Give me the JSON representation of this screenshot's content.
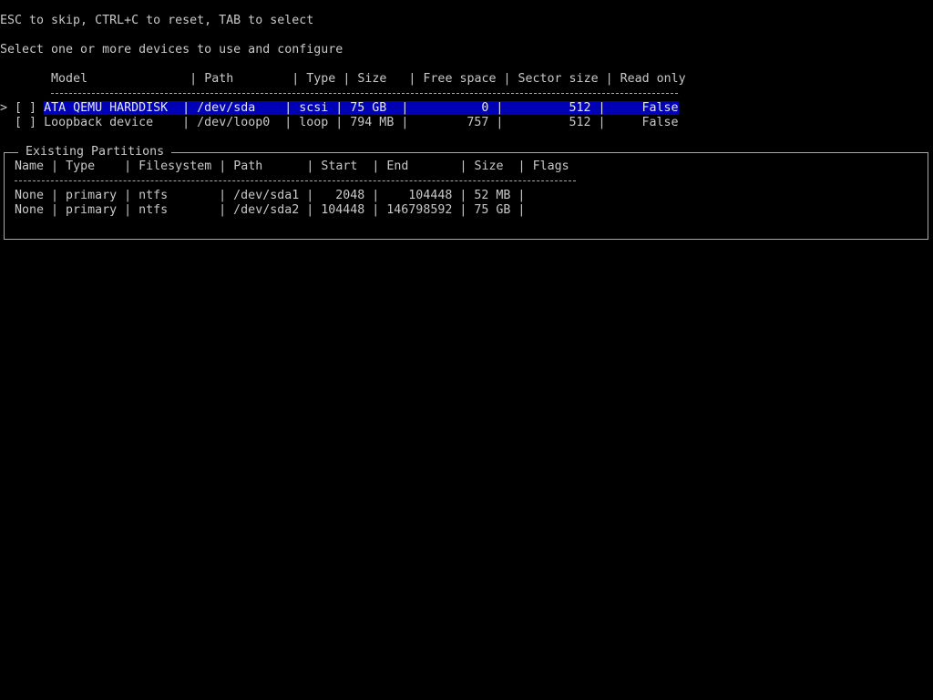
{
  "header": {
    "hint": "ESC to skip, CTRL+C to reset, TAB to select",
    "prompt": "Select one or more devices to use and configure"
  },
  "devices": {
    "columns": [
      "Model",
      "Path",
      "Type",
      "Size",
      "Free space",
      "Sector size",
      "Read only"
    ],
    "rows": [
      {
        "cursor": ">",
        "checkbox": "[ ]",
        "model": "ATA QEMU HARDDISK",
        "path": "/dev/sda",
        "type": "scsi",
        "size": "75 GB",
        "free": "0",
        "sector": "512",
        "readonly": "False",
        "selected": true
      },
      {
        "cursor": " ",
        "checkbox": "[ ]",
        "model": "Loopback device",
        "path": "/dev/loop0",
        "type": "loop",
        "size": "794 MB",
        "free": "757",
        "sector": "512",
        "readonly": "False",
        "selected": false
      }
    ]
  },
  "partitions": {
    "title": "Existing Partitions",
    "columns": [
      "Name",
      "Type",
      "Filesystem",
      "Path",
      "Start",
      "End",
      "Size",
      "Flags"
    ],
    "rows": [
      {
        "name": "None",
        "type": "primary",
        "fs": "ntfs",
        "path": "/dev/sda1",
        "start": "2048",
        "end": "104448",
        "size": "52 MB",
        "flags": ""
      },
      {
        "name": "None",
        "type": "primary",
        "fs": "ntfs",
        "path": "/dev/sda2",
        "start": "104448",
        "end": "146798592",
        "size": "75 GB",
        "flags": ""
      }
    ]
  },
  "colors": {
    "background": "#000000",
    "text": "#c8c8c8",
    "highlight_bg": "#0000b4"
  }
}
